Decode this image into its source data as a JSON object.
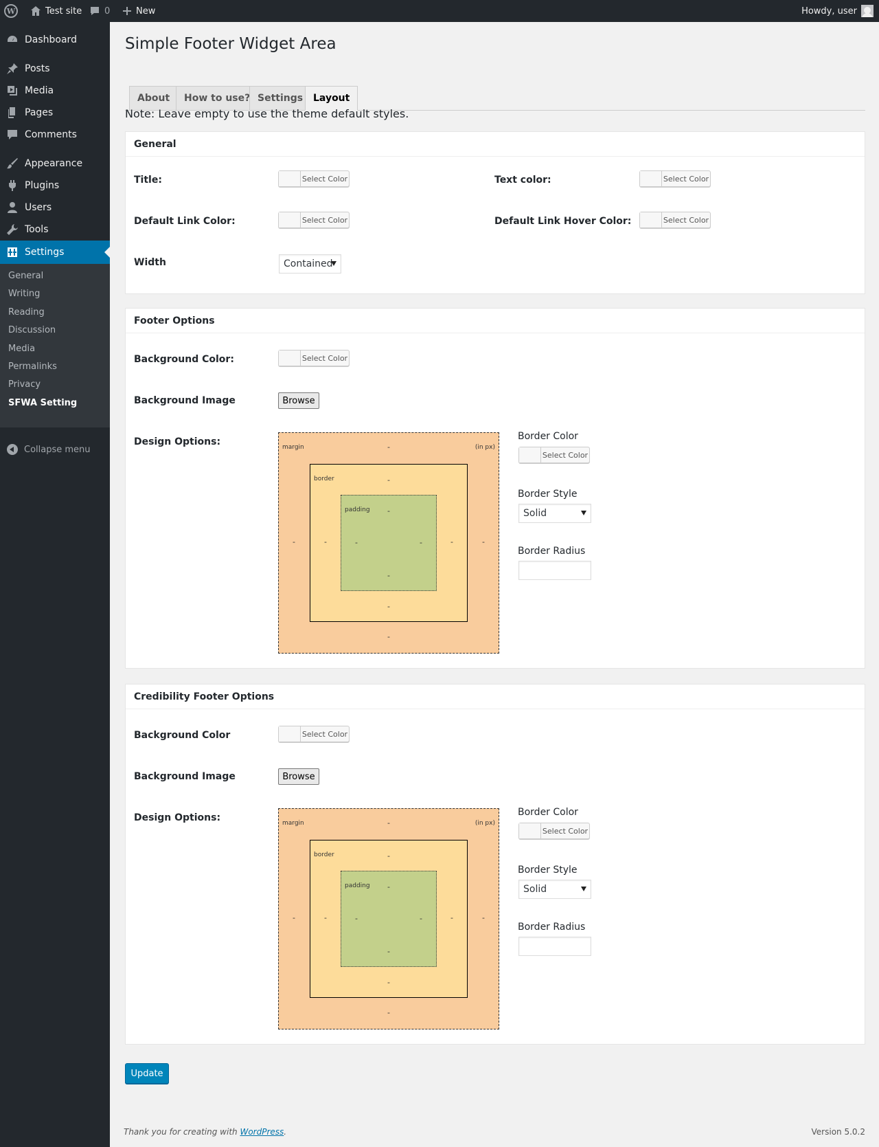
{
  "adminbar": {
    "site_name": "Test site",
    "comments_count": "0",
    "new_label": "New",
    "howdy": "Howdy, user"
  },
  "sidebar": {
    "items": [
      {
        "label": "Dashboard",
        "icon": "dashboard-icon"
      },
      {
        "label": "Posts",
        "icon": "pin-icon"
      },
      {
        "label": "Media",
        "icon": "media-icon"
      },
      {
        "label": "Pages",
        "icon": "pages-icon"
      },
      {
        "label": "Comments",
        "icon": "comment-icon"
      },
      {
        "label": "Appearance",
        "icon": "brush-icon"
      },
      {
        "label": "Plugins",
        "icon": "plug-icon"
      },
      {
        "label": "Users",
        "icon": "user-icon"
      },
      {
        "label": "Tools",
        "icon": "wrench-icon"
      },
      {
        "label": "Settings",
        "icon": "settings-icon"
      }
    ],
    "submenu": [
      "General",
      "Writing",
      "Reading",
      "Discussion",
      "Media",
      "Permalinks",
      "Privacy",
      "SFWA Setting"
    ],
    "collapse": "Collapse menu"
  },
  "page": {
    "title": "Simple Footer Widget Area",
    "tabs": [
      "About",
      "How to use?",
      "Settings",
      "Layout"
    ],
    "note": "Note: Leave empty to use the theme default styles."
  },
  "general": {
    "heading": "General",
    "title_label": "Title:",
    "text_color_label": "Text color:",
    "link_color_label": "Default Link Color:",
    "link_hover_label": "Default Link Hover Color:",
    "width_label": "Width",
    "width_value": "Contained"
  },
  "color_button": "Select Color",
  "footer_options": {
    "heading": "Footer Options",
    "bg_color_label": "Background Color:",
    "bg_image_label": "Background Image",
    "design_label": "Design Options:"
  },
  "cred_options": {
    "heading": "Credibility Footer Options",
    "bg_color_label": "Background Color",
    "bg_image_label": "Background Image",
    "design_label": "Design Options:"
  },
  "browse_label": "Browse",
  "boxmodel": {
    "margin": "margin",
    "unit": "(in px)",
    "border": "border",
    "padding": "padding",
    "dash": "-"
  },
  "border_side": {
    "border_color": "Border Color",
    "border_style": "Border Style",
    "border_style_value": "Solid",
    "border_radius": "Border Radius"
  },
  "update_label": "Update",
  "footer": {
    "thanks_prefix": "Thank you for creating with ",
    "wordpress_link": "WordPress",
    "thanks_suffix": ".",
    "version": "Version 5.0.2"
  }
}
